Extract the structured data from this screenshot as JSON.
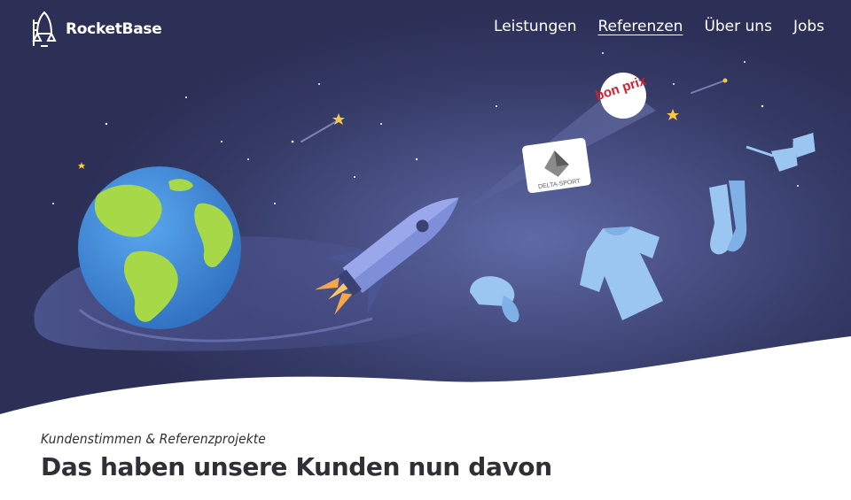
{
  "brand": {
    "name": "RocketBase"
  },
  "nav": {
    "items": [
      {
        "label": "Leistungen",
        "active": false
      },
      {
        "label": "Referenzen",
        "active": true
      },
      {
        "label": "Über uns",
        "active": false
      },
      {
        "label": "Jobs",
        "active": false
      }
    ]
  },
  "hero": {
    "logos": {
      "bonprix": "bon prix",
      "delta": "DELTA-SPORT"
    }
  },
  "section": {
    "eyebrow": "Kundenstimmen & Referenzprojekte",
    "headline": "Das haben unsere Kunden nun davon"
  },
  "colors": {
    "sky_dark": "#2c3057",
    "sky_light": "#5f6aa6",
    "clothing": "#9cc6f2",
    "ocean": "#4a8fd6",
    "land": "#a7d848"
  }
}
